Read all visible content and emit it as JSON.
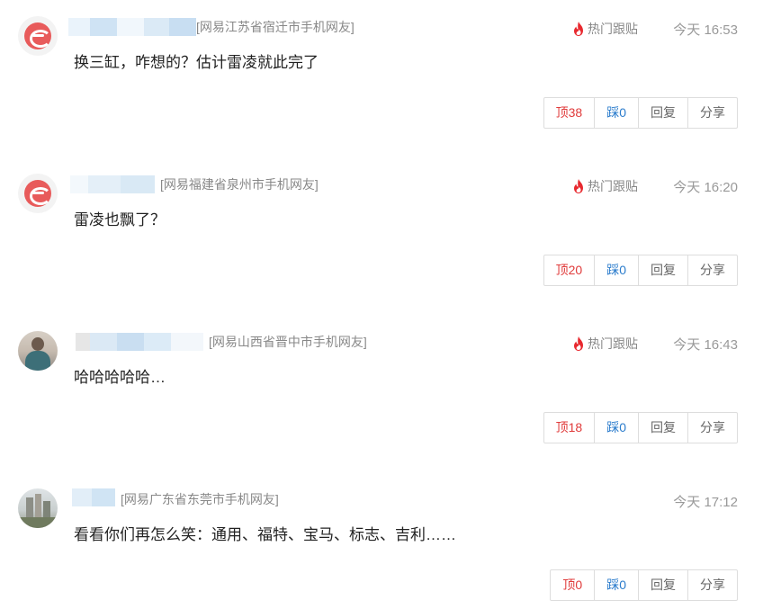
{
  "colors": {
    "up": "#e03b3b",
    "down": "#2b7ccc",
    "hot": "#e8292f",
    "meta": "#888888"
  },
  "comments": [
    {
      "meta": "[网易江苏省宿迁市手机网友]",
      "hot_label": "热门跟贴",
      "time": "今天 16:53",
      "content": "换三缸，咋想的？估计雷凌就此完了",
      "up": "顶38",
      "down": "踩0",
      "reply": "回复",
      "share": "分享",
      "avatar": "netease-logo-avatar"
    },
    {
      "meta": "[网易福建省泉州市手机网友]",
      "hot_label": "热门跟贴",
      "time": "今天 16:20",
      "content": "雷凌也飘了？",
      "up": "顶20",
      "down": "踩0",
      "reply": "回复",
      "share": "分享",
      "avatar": "netease-logo-avatar"
    },
    {
      "meta": "[网易山西省晋中市手机网友]",
      "hot_label": "热门跟贴",
      "time": "今天 16:43",
      "content": "哈哈哈哈哈…",
      "up": "顶18",
      "down": "踩0",
      "reply": "回复",
      "share": "分享",
      "avatar": "person-photo-avatar"
    },
    {
      "meta": "[网易广东省东莞市手机网友]",
      "time": "今天 17:12",
      "content": "看看你们再怎么笑：通用、福特、宝马、标志、吉利……",
      "up": "顶0",
      "down": "踩0",
      "reply": "回复",
      "share": "分享",
      "avatar": "city-photo-avatar"
    }
  ]
}
